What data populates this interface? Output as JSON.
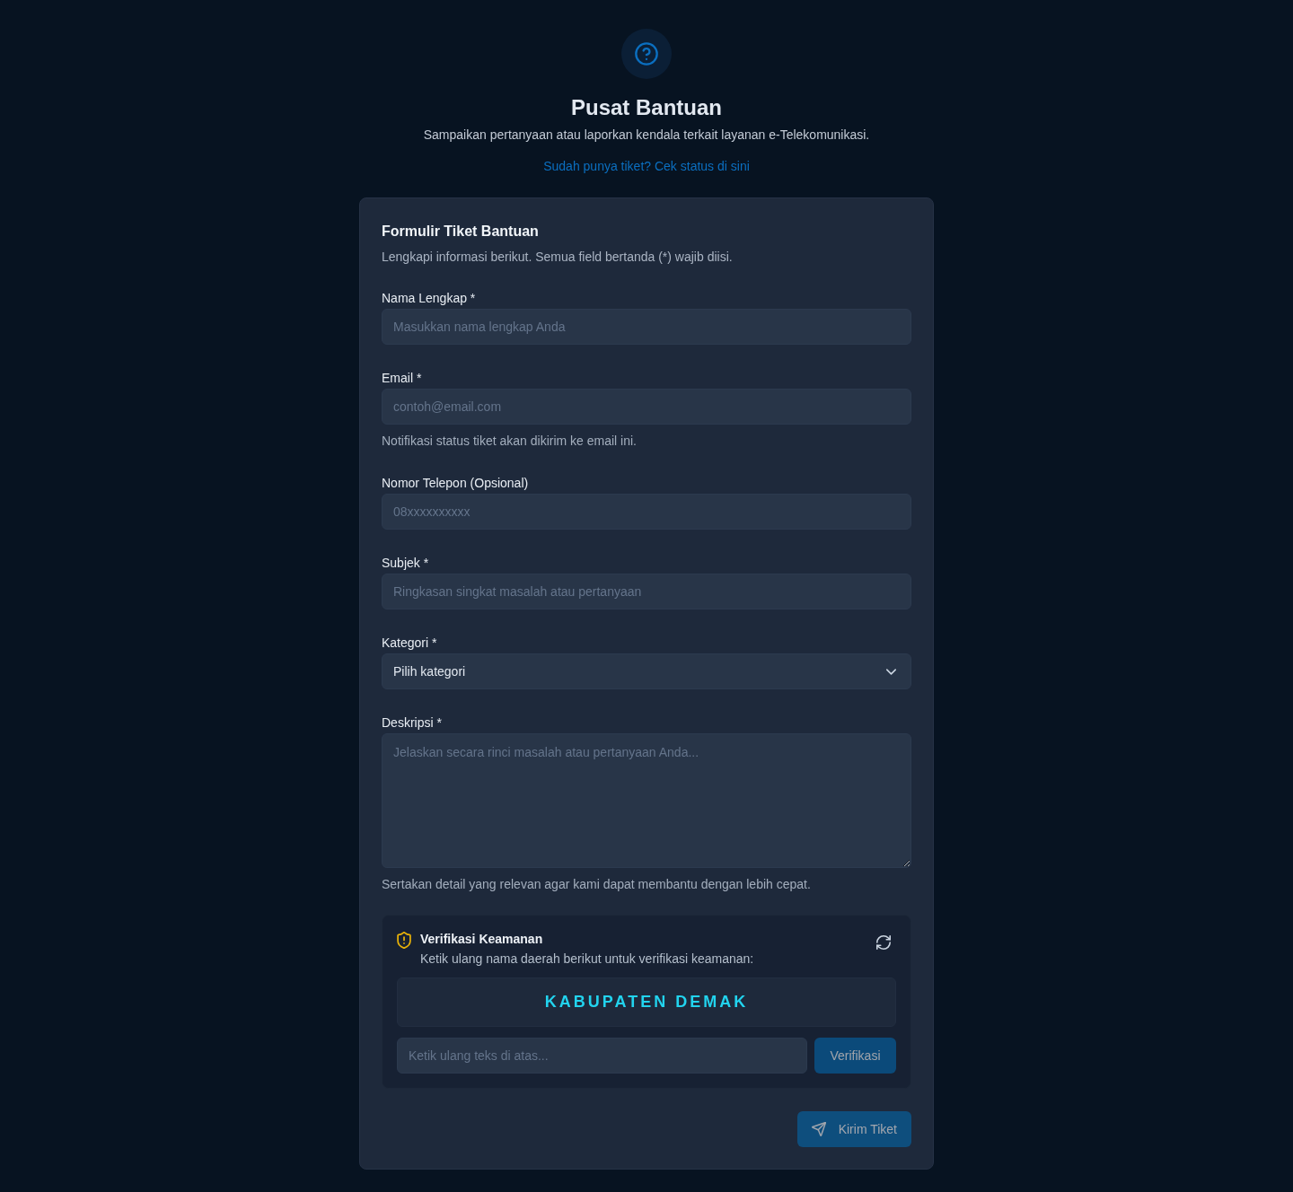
{
  "header": {
    "title": "Pusat Bantuan",
    "subtitle": "Sampaikan pertanyaan atau laporkan kendala terkait layanan e-Telekomunikasi.",
    "status_link": "Sudah punya tiket? Cek status di sini"
  },
  "form": {
    "title": "Formulir Tiket Bantuan",
    "description": "Lengkapi informasi berikut. Semua field bertanda (*) wajib diisi.",
    "fields": [
      {
        "kind": "text",
        "label": "Nama Lengkap *",
        "placeholder": "Masukkan nama lengkap Anda"
      },
      {
        "kind": "text",
        "label": "Email *",
        "placeholder": "contoh@email.com",
        "hint": "Notifikasi status tiket akan dikirim ke email ini."
      },
      {
        "kind": "text",
        "label": "Nomor Telepon (Opsional)",
        "placeholder": "08xxxxxxxxxx"
      },
      {
        "kind": "text",
        "label": "Subjek *",
        "placeholder": "Ringkasan singkat masalah atau pertanyaan"
      },
      {
        "kind": "select",
        "label": "Kategori *",
        "value": "Pilih kategori"
      },
      {
        "kind": "textarea",
        "label": "Deskripsi *",
        "placeholder": "Jelaskan secara rinci masalah atau pertanyaan Anda...",
        "hint": "Sertakan detail yang relevan agar kami dapat membantu dengan lebih cepat."
      }
    ],
    "verification": {
      "title": "Verifikasi Keamanan",
      "instruction": "Ketik ulang nama daerah berikut untuk verifikasi keamanan:",
      "challenge": "KABUPATEN DEMAK",
      "answer_placeholder": "Ketik ulang teks di atas...",
      "verify_button": {
        "label": "Verifikasi",
        "disabled": true
      }
    },
    "submit_button": {
      "label": "Kirim Tiket",
      "disabled": true
    }
  }
}
